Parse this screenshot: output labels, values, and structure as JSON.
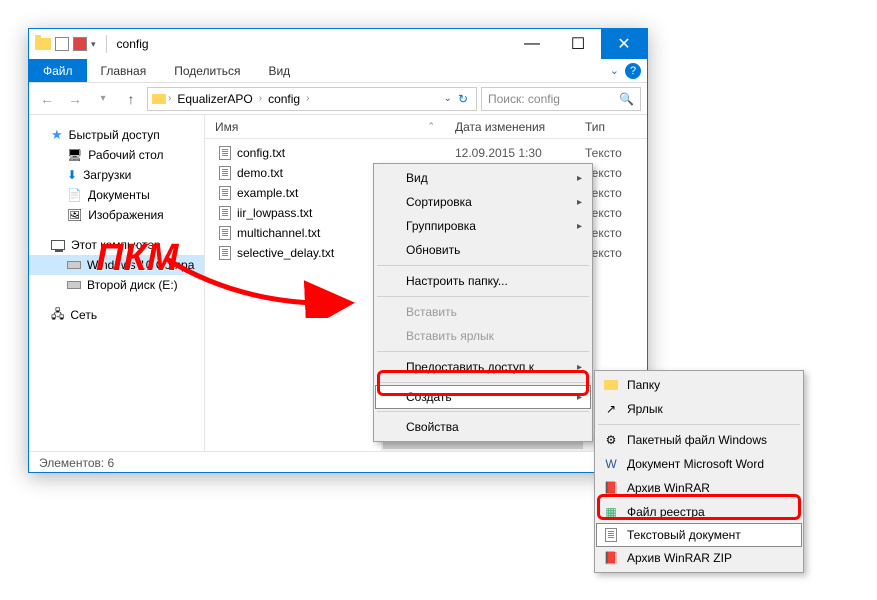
{
  "window": {
    "title": "config"
  },
  "ribbon": {
    "file": "Файл",
    "home": "Главная",
    "share": "Поделиться",
    "view": "Вид"
  },
  "breadcrumb": {
    "seg1": "EqualizerAPO",
    "seg2": "config"
  },
  "search": {
    "placeholder": "Поиск: config"
  },
  "columns": {
    "name": "Имя",
    "date": "Дата изменения",
    "type": "Тип"
  },
  "nav": {
    "quick": "Быстрый доступ",
    "desktop": "Рабочий стол",
    "downloads": "Загрузки",
    "documents": "Документы",
    "pictures": "Изображения",
    "thispc": "Этот компьютер",
    "win10": "Windows 10 Compa",
    "disk2": "Второй диск (E:)",
    "network": "Сеть"
  },
  "files": [
    {
      "name": "config.txt",
      "date": "12.09.2015 1:30",
      "type": "Тексто"
    },
    {
      "name": "demo.txt",
      "date": "",
      "type": "Тексто"
    },
    {
      "name": "example.txt",
      "date": "",
      "type": "Тексто"
    },
    {
      "name": "iir_lowpass.txt",
      "date": "",
      "type": "Тексто"
    },
    {
      "name": "multichannel.txt",
      "date": "",
      "type": "Тексто"
    },
    {
      "name": "selective_delay.txt",
      "date": "",
      "type": "Тексто"
    }
  ],
  "status": {
    "count": "Элементов: 6"
  },
  "ctx1": {
    "view": "Вид",
    "sort": "Сортировка",
    "group": "Группировка",
    "refresh": "Обновить",
    "customize": "Настроить папку...",
    "paste": "Вставить",
    "paste_shortcut": "Вставить ярлык",
    "give_access": "Предоставить доступ к",
    "create": "Создать",
    "properties": "Свойства"
  },
  "ctx2": {
    "folder": "Папку",
    "shortcut": "Ярлык",
    "batch": "Пакетный файл Windows",
    "word": "Документ Microsoft Word",
    "winrar": "Архив WinRAR",
    "registry": "Файл реестра",
    "textdoc": "Текстовый документ",
    "winrarzip": "Архив WinRAR ZIP"
  },
  "annotation": {
    "label": "ПКМ"
  }
}
